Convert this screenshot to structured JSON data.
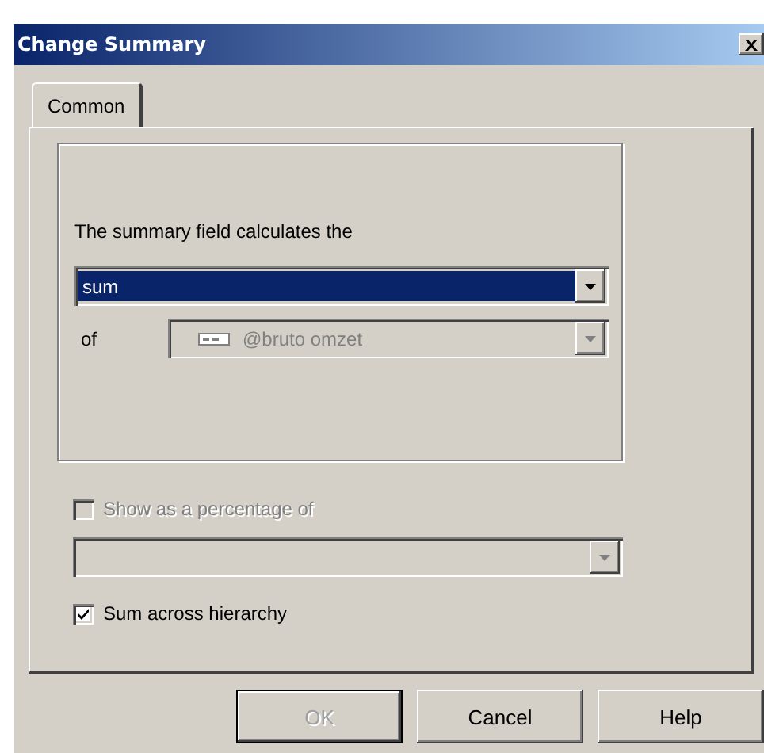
{
  "window": {
    "title": "Change Summary"
  },
  "tabs": [
    {
      "label": "Common",
      "selected": true
    }
  ],
  "summary": {
    "label": "The summary field calculates the",
    "function": {
      "value": "sum",
      "focused": true,
      "disabled": false
    },
    "of": {
      "label": "of",
      "value": "@bruto omzet",
      "disabled": true
    }
  },
  "percentage": {
    "label": "Show as a percentage of",
    "checked": false,
    "disabled": true,
    "combo": {
      "disabled": true
    }
  },
  "hierarchy": {
    "label": "Sum across hierarchy",
    "checked": true,
    "disabled": false
  },
  "buttons": [
    {
      "label": "OK",
      "disabled": true,
      "default": true
    },
    {
      "label": "Cancel",
      "disabled": false,
      "default": false
    },
    {
      "label": "Help",
      "disabled": false,
      "default": false
    }
  ]
}
